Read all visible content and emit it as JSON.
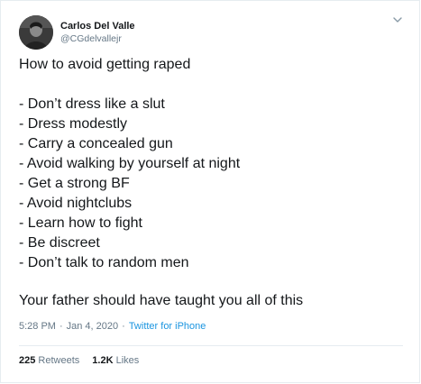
{
  "author": {
    "display_name": "Carlos Del Valle",
    "handle": "@CGdelvallejr",
    "avatar_icon": "profile-photo"
  },
  "tweet": {
    "title_line": "How to avoid getting raped",
    "list": [
      "- Don’t dress like a slut",
      "- Dress modestly",
      "- Carry a concealed gun",
      "- Avoid walking by yourself at night",
      "- Get a strong BF",
      "- Avoid nightclubs",
      "- Learn how to fight",
      "- Be discreet",
      "- Don’t talk to random men"
    ],
    "closing_line": "Your father should have taught you all of this"
  },
  "meta": {
    "time": "5:28 PM",
    "separator": "·",
    "date": "Jan 4, 2020",
    "source": "Twitter for iPhone"
  },
  "stats": {
    "retweets_count": "225",
    "retweets_label": "Retweets",
    "likes_count": "1.2K",
    "likes_label": "Likes"
  },
  "colors": {
    "text": "#14171a",
    "secondary": "#657786",
    "link": "#1b95e0",
    "border": "#e6ecf0"
  }
}
